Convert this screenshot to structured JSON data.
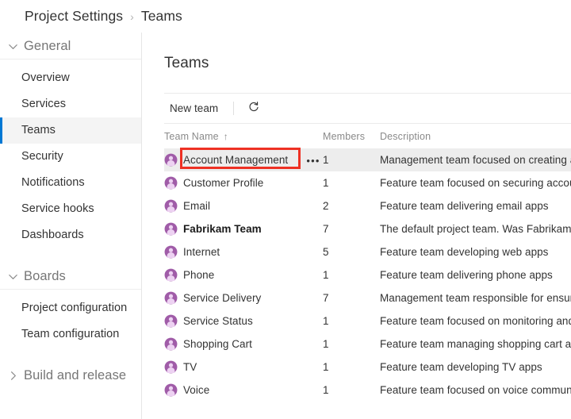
{
  "breadcrumb": {
    "root": "Project Settings",
    "separator": "›",
    "current": "Teams"
  },
  "sidebar": {
    "groups": [
      {
        "label": "General",
        "expanded": true,
        "chevron_icon": "chevron-down-icon",
        "items": [
          {
            "label": "Overview",
            "selected": false
          },
          {
            "label": "Services",
            "selected": false
          },
          {
            "label": "Teams",
            "selected": true
          },
          {
            "label": "Security",
            "selected": false
          },
          {
            "label": "Notifications",
            "selected": false
          },
          {
            "label": "Service hooks",
            "selected": false
          },
          {
            "label": "Dashboards",
            "selected": false
          }
        ]
      },
      {
        "label": "Boards",
        "expanded": true,
        "chevron_icon": "chevron-down-icon",
        "items": [
          {
            "label": "Project configuration",
            "selected": false
          },
          {
            "label": "Team configuration",
            "selected": false
          }
        ]
      },
      {
        "label": "Build and release",
        "expanded": false,
        "chevron_icon": "chevron-right-icon",
        "items": []
      }
    ],
    "accent_color": "#0078d4",
    "selected_bg": "#f4f4f4"
  },
  "main": {
    "heading": "Teams",
    "toolbar": {
      "new_team_label": "New team",
      "refresh_icon": "refresh-icon",
      "refresh_title": "Refresh"
    },
    "table": {
      "columns": [
        {
          "key": "name",
          "label": "Team Name",
          "sorted": true,
          "sort_direction": "asc",
          "sort_glyph": "↑"
        },
        {
          "key": "members",
          "label": "Members",
          "sorted": false
        },
        {
          "key": "desc",
          "label": "Description",
          "sorted": false
        }
      ],
      "avatar_icon": "team-avatar-icon",
      "row_menu_icon": "more-actions-icon",
      "row_menu_glyph": "•••",
      "rows": [
        {
          "name": "Account Management",
          "members": "1",
          "description": "Management team focused on creating and",
          "bold": false,
          "active": true,
          "highlighted": true,
          "show_menu": true
        },
        {
          "name": "Customer Profile",
          "members": "1",
          "description": "Feature team focused on securing account",
          "bold": false,
          "active": false,
          "highlighted": false,
          "show_menu": false
        },
        {
          "name": "Email",
          "members": "2",
          "description": "Feature team delivering email apps",
          "bold": false,
          "active": false,
          "highlighted": false,
          "show_menu": false
        },
        {
          "name": "Fabrikam Team",
          "members": "7",
          "description": "The default project team. Was Fabrikam Fi",
          "bold": true,
          "active": false,
          "highlighted": false,
          "show_menu": false
        },
        {
          "name": "Internet",
          "members": "5",
          "description": "Feature team developing web apps",
          "bold": false,
          "active": false,
          "highlighted": false,
          "show_menu": false
        },
        {
          "name": "Phone",
          "members": "1",
          "description": "Feature team delivering phone apps",
          "bold": false,
          "active": false,
          "highlighted": false,
          "show_menu": false
        },
        {
          "name": "Service Delivery",
          "members": "7",
          "description": "Management team responsible for ensure",
          "bold": false,
          "active": false,
          "highlighted": false,
          "show_menu": false
        },
        {
          "name": "Service Status",
          "members": "1",
          "description": "Feature team focused on monitoring and .",
          "bold": false,
          "active": false,
          "highlighted": false,
          "show_menu": false
        },
        {
          "name": "Shopping Cart",
          "members": "1",
          "description": "Feature team managing shopping cart app",
          "bold": false,
          "active": false,
          "highlighted": false,
          "show_menu": false
        },
        {
          "name": "TV",
          "members": "1",
          "description": "Feature team developing TV apps",
          "bold": false,
          "active": false,
          "highlighted": false,
          "show_menu": false
        },
        {
          "name": "Voice",
          "members": "1",
          "description": "Feature team focused on voice communic",
          "bold": false,
          "active": false,
          "highlighted": false,
          "show_menu": false
        }
      ]
    }
  },
  "annotation": {
    "target": "Account Management",
    "box_color": "#ee3124"
  },
  "colors": {
    "accent": "#0078d4",
    "avatar_purple": "#a05ca8",
    "avatar_fill": "#e9c9ee",
    "annotation_red": "#ee3124",
    "text": "#333333",
    "muted_text": "#8a8a8a"
  }
}
